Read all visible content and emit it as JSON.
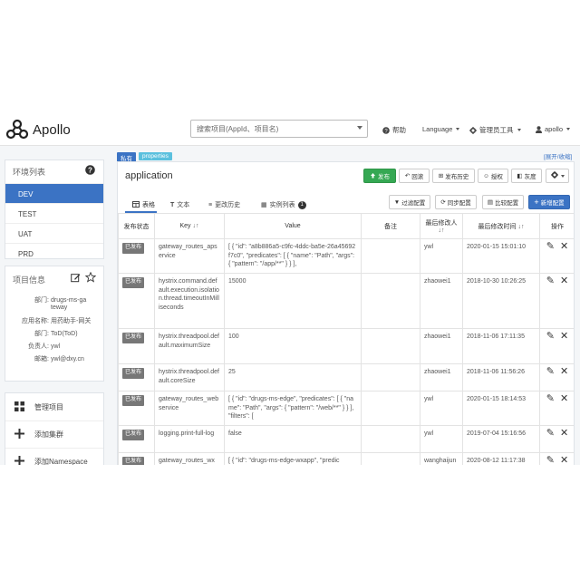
{
  "navbar": {
    "brand": "Apollo",
    "search_placeholder": "搜索项目(AppId、项目名)",
    "help": "帮助",
    "language": "Language",
    "admin_tools": "管理员工具",
    "user": "apollo"
  },
  "top_link": "[展开/收缩]",
  "env_panel": {
    "title": "环境列表",
    "items": [
      "DEV",
      "TEST",
      "UAT",
      "PRD"
    ],
    "active": "DEV"
  },
  "project_panel": {
    "title": "项目信息",
    "fields": [
      {
        "key": "部门:",
        "value": "drugs-ms-ga"
      },
      {
        "key": "",
        "value": "teway"
      },
      {
        "key": "应用名称:",
        "value": "用药助手-网关"
      },
      {
        "key": "部门:",
        "value": "ToD(ToD)"
      },
      {
        "key": "负责人:",
        "value": "ywl"
      },
      {
        "key": "邮箱:",
        "value": "ywl@dxy.cn"
      }
    ]
  },
  "side_actions": [
    {
      "icon": "grid-icon",
      "label": "管理项目"
    },
    {
      "icon": "plus-icon",
      "label": "添加集群"
    },
    {
      "icon": "plus-icon",
      "label": "添加Namespace"
    }
  ],
  "namespace_tags": [
    {
      "label": "私有",
      "color": "#3b73c4"
    },
    {
      "label": "properties",
      "color": "#5bc0de"
    }
  ],
  "app": {
    "title": "application",
    "buttons": {
      "release": "发布",
      "rollback": "回滚",
      "history": "发布历史",
      "auth": "授权",
      "gray": "灰度"
    },
    "tabs": [
      "表格",
      "文本",
      "更改历史",
      "实例列表"
    ],
    "instance_count": "1",
    "tools": {
      "filter": "过滤配置",
      "sync": "同步配置",
      "compare": "比较配置",
      "add": "新增配置"
    }
  },
  "table": {
    "headers": [
      "发布状态",
      "Key",
      "Value",
      "备注",
      "最后修改人",
      "最后修改时间",
      "操作"
    ],
    "rows": [
      {
        "status": "已发布",
        "key": "gateway_routes_apservice",
        "value": "[ { \"id\": \"a8b886a5-c9fc-4ddc-ba5e-26a45692f7c0\", \"predicates\": [ { \"name\": \"Path\", \"args\": { \"pattern\": \"/app/**\" } } ],",
        "comment": "",
        "modifier": "ywl",
        "time": "2020-01-15 15:01:10"
      },
      {
        "status": "已发布",
        "key": "hystrix.command.default.execution.isolation.thread.timeoutInMilliseconds",
        "value": "15000",
        "comment": "",
        "modifier": "zhaowei1",
        "time": "2018-10-30 10:26:25"
      },
      {
        "status": "已发布",
        "key": "hystrix.threadpool.default.maximumSize",
        "value": "100",
        "comment": "",
        "modifier": "zhaowei1",
        "time": "2018-11-06 17:11:35"
      },
      {
        "status": "已发布",
        "key": "hystrix.threadpool.default.coreSize",
        "value": "25",
        "comment": "",
        "modifier": "zhaowei1",
        "time": "2018-11-06 11:56:26"
      },
      {
        "status": "已发布",
        "key": "gateway_routes_webservice",
        "value": "[ { \"id\": \"drugs-ms-edge\", \"predicates\": [ { \"name\": \"Path\", \"args\": { \"pattern\": \"/web/**\" } } ], \"filters\": [",
        "comment": "",
        "modifier": "ywl",
        "time": "2020-01-15 18:14:53"
      },
      {
        "status": "已发布",
        "key": "logging.print-full-log",
        "value": "false",
        "comment": "",
        "modifier": "ywl",
        "time": "2019-07-04 15:16:56"
      },
      {
        "status": "已发布",
        "key": "gateway_routes_wx",
        "value": "[ { \"id\": \"drugs-ms-edge-wxapp\", \"predic",
        "comment": "",
        "modifier": "wanghaijun",
        "time": "2020-08-12 11:17:38"
      }
    ]
  }
}
